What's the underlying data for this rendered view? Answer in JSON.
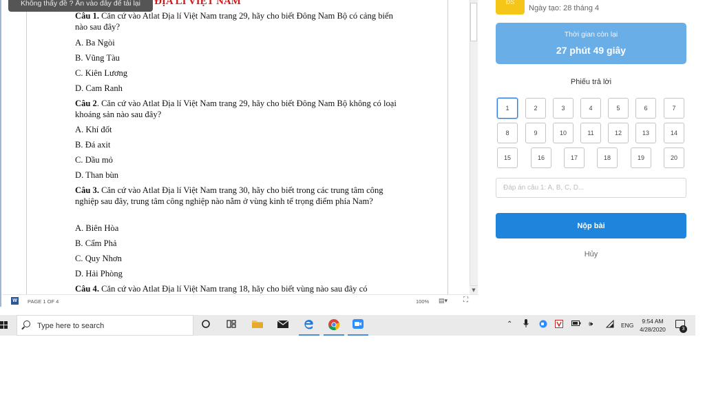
{
  "document": {
    "tooltip": "Không thấy đề ? Ấn vào đây để tải lại",
    "title": "BÀI TẬP ATLAT ĐỊA LÍ VIỆT NAM",
    "questions": [
      {
        "label": "Câu 1.",
        "text": " Căn cứ vào Atlat Địa lí Việt Nam trang 29, hãy cho biết Đông Nam Bộ có cảng biển nào sau đây?",
        "options": [
          "A. Ba Ngòi",
          "B. Vũng Tàu",
          "C. Kiên Lương",
          "D. Cam Ranh"
        ]
      },
      {
        "label": "Câu 2",
        "text": ". Căn cứ vào Atlat Địa lí Việt Nam trang 29, hãy cho biết Đông Nam Bộ không có loại khoáng sản nào sau đây?",
        "options": [
          "A. Khí đốt",
          "B. Đá axit",
          "C. Dầu mỏ",
          "D. Than bùn"
        ]
      },
      {
        "label": "Câu 3.",
        "text": " Căn cứ vào Atlat Địa lí Việt Nam trang 30, hãy cho biết trong các trung tâm công nghiệp sau đây, trung tâm công nghiệp nào nằm ở vùng kinh tế trọng điểm phía Nam?",
        "options": [
          "A. Biên Hòa",
          "B. Cẩm Phả",
          "C. Quy Nhơn",
          "D. Hải Phòng"
        ]
      },
      {
        "label": "Câu 4.",
        "text": " Căn cứ vào Atlat Địa lí Việt Nam trang 18, hãy cho biết vùng nào sau đây có",
        "options": []
      }
    ],
    "status": {
      "page": "PAGE 1 OF 4",
      "zoom": "100%"
    }
  },
  "quiz": {
    "badge": "ĐS",
    "created": "Ngày tạo: 28 tháng 4",
    "timer_label": "Thời gian còn lại",
    "timer_value": "27 phút 49 giây",
    "sheet_title": "Phiếu trả lời",
    "answers": [
      "1",
      "2",
      "3",
      "4",
      "5",
      "6",
      "7",
      "8",
      "9",
      "10",
      "11",
      "12",
      "13",
      "14",
      "15",
      "16",
      "17",
      "18",
      "19",
      "20"
    ],
    "active_answer": 1,
    "input_placeholder": "Đáp án câu 1: A, B, C, D...",
    "submit_label": "Nộp bài",
    "cancel_label": "Hủy"
  },
  "taskbar": {
    "search_placeholder": "Type here to search",
    "language": "ENG",
    "time": "9:54 AM",
    "date": "4/28/2020",
    "notifications": "3",
    "app_icons": [
      "task-view-icon",
      "file-explorer-icon",
      "mail-icon",
      "edge-icon",
      "chrome-icon",
      "zoom-icon"
    ],
    "colors": {
      "accent": "#1f84dc",
      "timer": "#6aaee8",
      "badge": "#f5c518",
      "title_red": "#d01919"
    }
  }
}
